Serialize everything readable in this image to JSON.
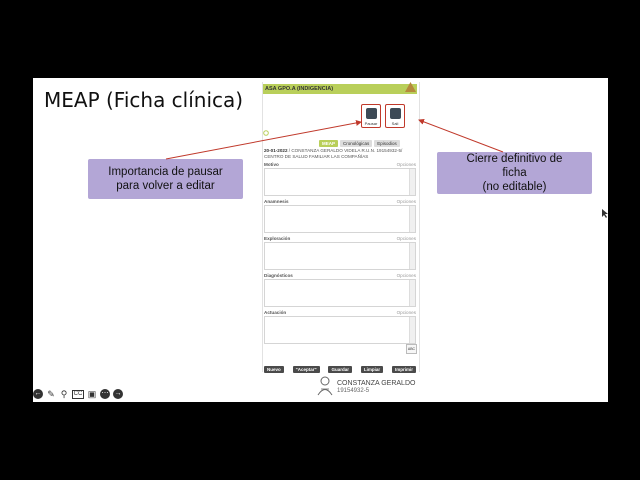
{
  "slide": {
    "title": "MEAP (Ficha clínica)",
    "callout_left": {
      "line1": "Importancia de pausar",
      "line2": "para volver a editar"
    },
    "callout_right": {
      "line1": "Cierre definitivo de",
      "line2": "ficha",
      "line3": "(no editable)"
    }
  },
  "app": {
    "header": "ASA GPO.A (INDIGENCIA)",
    "buttons": {
      "pause": "Pausar",
      "exit": "Sali"
    },
    "tabs": [
      {
        "label": "MEAP"
      },
      {
        "label": "Cronológicas"
      },
      {
        "label": "Episodios"
      }
    ],
    "patient": {
      "line1_date": "20-01-2022",
      "line1_rest": " / CONSTANZA   GERALDO   VIDELA R.U.N. 19154932-5/",
      "line2": "CENTRO DE SALUD FAMILIAR LAS COMPAÑÍAS"
    },
    "options_label": "Opciones",
    "sections": [
      {
        "label": "Motivo"
      },
      {
        "label": "Anamnesis"
      },
      {
        "label": "Exploración"
      },
      {
        "label": "Diagnósticos"
      },
      {
        "label": "Actuación"
      }
    ],
    "abc_button": "ABC",
    "bottom_buttons": [
      "Nuevo",
      "\"Aceptar\"",
      "Guardar",
      "Limpiar",
      "Imprimir"
    ],
    "user": {
      "name": "CONSTANZA GERALDO",
      "id": "19154932-5"
    }
  },
  "colors": {
    "accent_green": "#b9cf5a",
    "callout": "#b3a6d6",
    "highlight_red": "#c0392b"
  }
}
